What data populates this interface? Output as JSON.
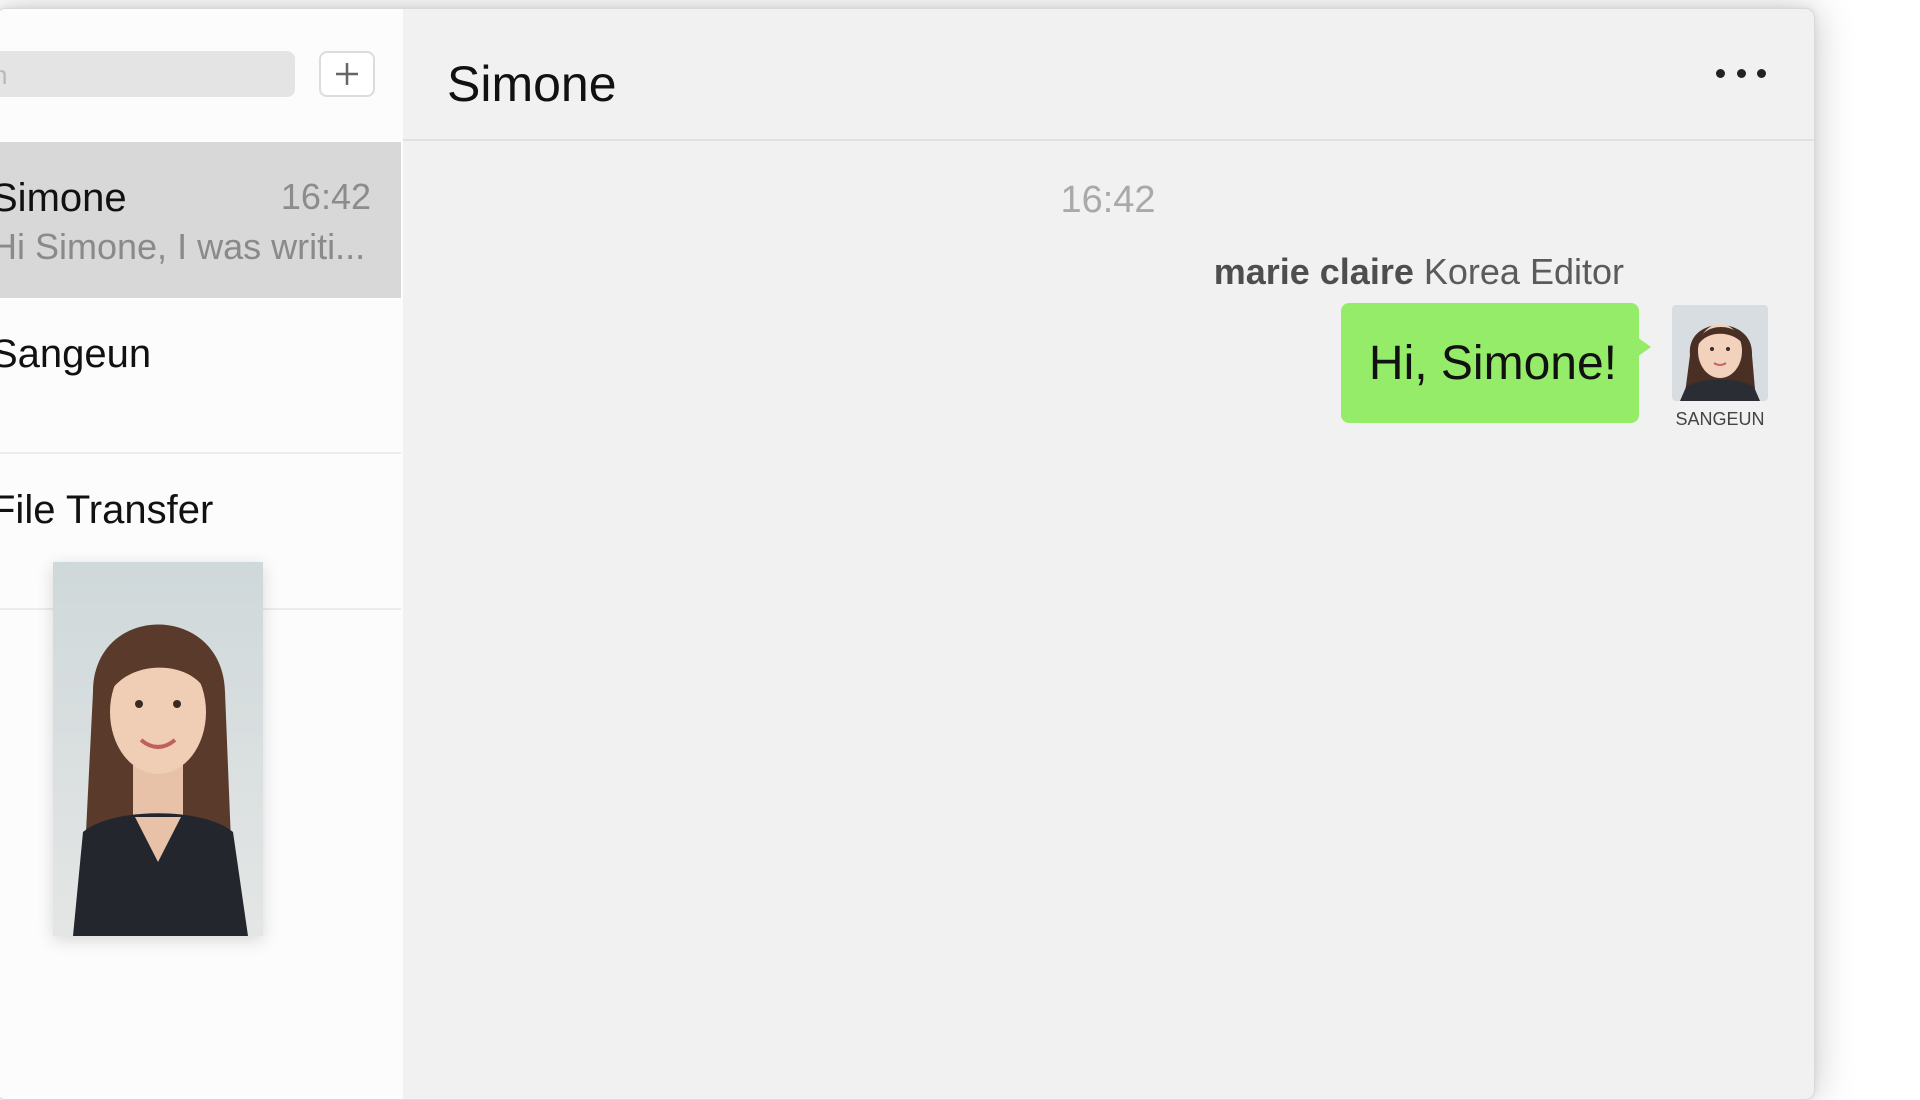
{
  "sidebar": {
    "search_placeholder": "n",
    "add_icon": "plus-icon",
    "conversations": [
      {
        "name": "Simone",
        "time": "16:42",
        "preview": "Hi Simone, I was writi..."
      },
      {
        "name": "Sangeun",
        "time": "",
        "preview": ""
      },
      {
        "name": "File Transfer",
        "time": "",
        "preview": ""
      }
    ]
  },
  "chat": {
    "title": "Simone",
    "more_icon": "more-dots-icon",
    "timestamp": "16:42",
    "sender_org": "marie claire",
    "sender_role": "Korea Editor",
    "message": "Hi, Simone!",
    "avatar_label": "SANGEUN"
  },
  "colors": {
    "bubble": "#95ec69",
    "active_row": "#d8d8d8",
    "background": "#f1f1f1"
  }
}
